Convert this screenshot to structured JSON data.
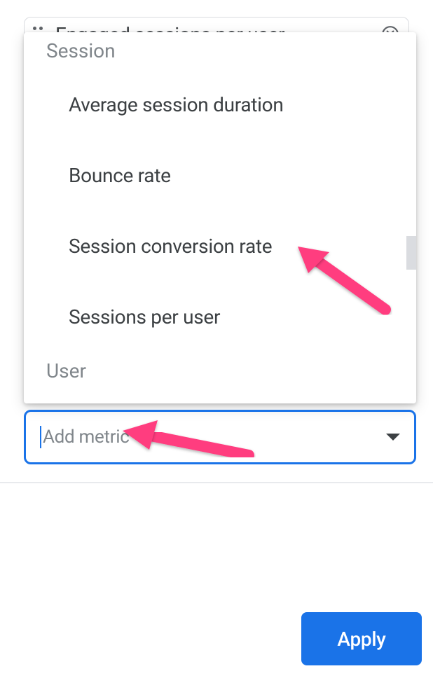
{
  "chip": {
    "label": "Engaged sessions per user"
  },
  "dropdown": {
    "category1": "Session",
    "items": [
      "Average session duration",
      "Bounce rate",
      "Session conversion rate",
      "Sessions per user"
    ],
    "category2": "User"
  },
  "add_metric": {
    "placeholder": "Add metric"
  },
  "apply_label": "Apply"
}
